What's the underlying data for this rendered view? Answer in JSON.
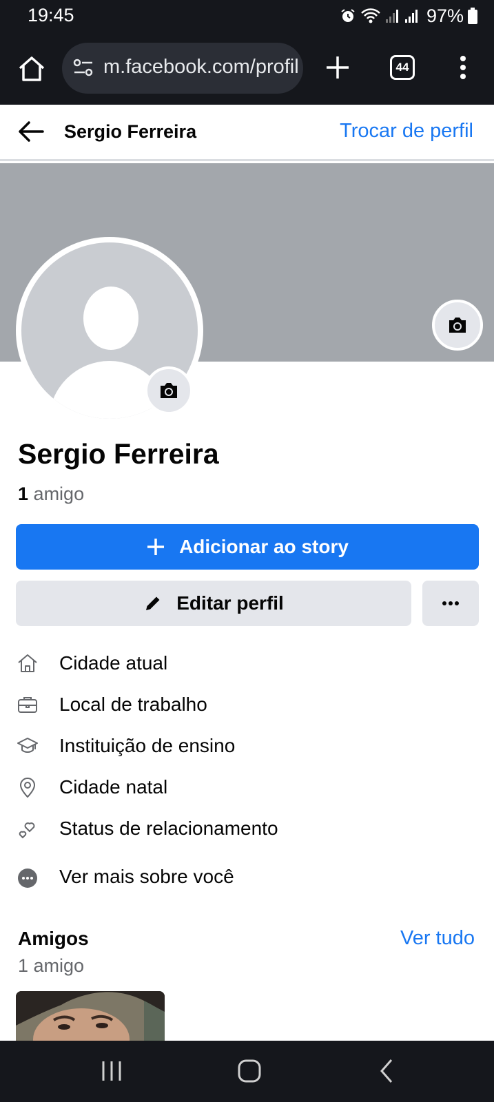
{
  "status_bar": {
    "time": "19:45",
    "battery": "97%",
    "icons": [
      "alarm-icon",
      "wifi-icon",
      "signal-icon",
      "signal-icon",
      "battery-icon"
    ]
  },
  "browser": {
    "url": "m.facebook.com/profile",
    "tab_count": "44",
    "icons": [
      "home-icon",
      "site-settings-icon",
      "plus-icon",
      "tabs-icon",
      "more-vert-icon"
    ]
  },
  "header": {
    "title": "Sergio Ferreira",
    "switch_profile": "Trocar de perfil"
  },
  "profile": {
    "name": "Sergio Ferreira",
    "friend_count": "1",
    "friend_word": "amigo"
  },
  "actions": {
    "add_story": "Adicionar ao story",
    "edit_profile": "Editar perfil"
  },
  "details": [
    {
      "icon": "home-icon",
      "label": "Cidade atual"
    },
    {
      "icon": "briefcase-icon",
      "label": "Local de trabalho"
    },
    {
      "icon": "graduation-cap-icon",
      "label": "Instituição de ensino"
    },
    {
      "icon": "location-pin-icon",
      "label": "Cidade natal"
    },
    {
      "icon": "hearts-icon",
      "label": "Status de relacionamento"
    },
    {
      "icon": "more-dots-icon",
      "label": "Ver mais sobre você"
    }
  ],
  "friends_section": {
    "title": "Amigos",
    "see_all": "Ver tudo",
    "subtitle": "1 amigo"
  },
  "colors": {
    "accent": "#1877f2",
    "system_bar": "#15171c",
    "cover": "#a3a7ac",
    "button_gray": "#e4e6eb"
  }
}
